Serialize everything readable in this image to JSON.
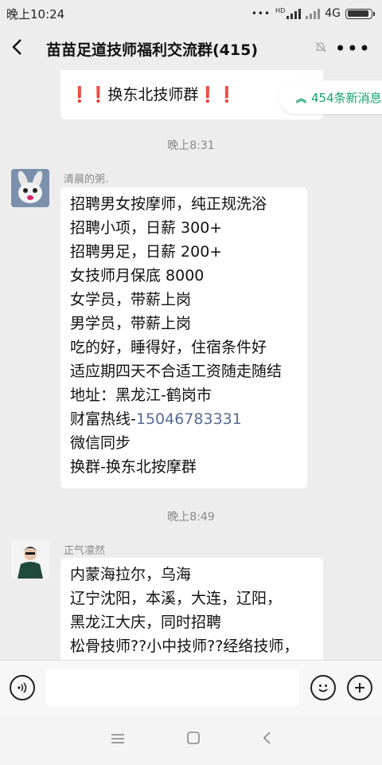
{
  "status": {
    "time": "晚上10:24",
    "network": "4G",
    "hd": "HD"
  },
  "header": {
    "title": "苗苗足道技师福利交流群(415)"
  },
  "new_messages": {
    "label": "454条新消息"
  },
  "messages": [
    {
      "text": "❗❗换东北技师群❗❗"
    },
    {
      "type": "time",
      "text": "晚上8:31"
    },
    {
      "sender": "清晨的粥.",
      "lines": [
        "招聘男女按摩师，纯正规洗浴",
        "招聘小项，日薪 300+",
        "招聘男足，日薪 200+",
        "女技师月保底 8000",
        "女学员，带薪上岗",
        "男学员，带薪上岗",
        "吃的好，睡得好，住宿条件好",
        "适应期四天不合适工资随走随结",
        "地址：黑龙江-鹤岗市"
      ],
      "phone_prefix": "财富热线-",
      "phone": "15046783331",
      "lines_after": [
        "微信同步",
        "换群-换东北按摩群"
      ]
    },
    {
      "type": "time",
      "text": "晚上8:49"
    },
    {
      "sender": "正气凛然",
      "lines": [
        "内蒙海拉尔，乌海",
        "辽宁沈阳，本溪，大连，辽阳，",
        "黑龙江大庆，同时招聘",
        "松骨技师??小中技师??经络技师，"
      ]
    }
  ],
  "colors": {
    "accent": "#12a36c",
    "link": "#576b95",
    "background": "#ededed"
  },
  "icons": [
    "back-icon",
    "mute-icon",
    "more-icon",
    "voice-icon",
    "emoji-icon",
    "plus-icon",
    "menu-icon",
    "home-icon",
    "nav-back-icon"
  ]
}
